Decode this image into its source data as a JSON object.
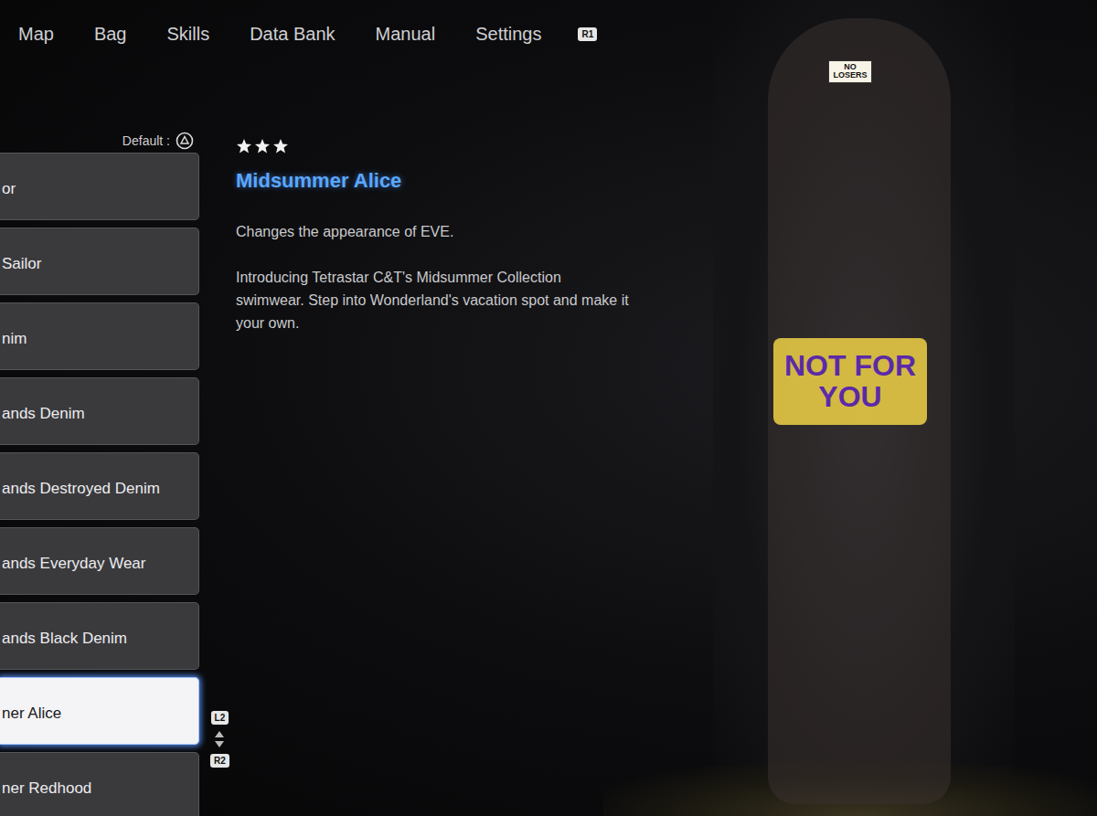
{
  "nav": {
    "items": [
      {
        "label": "Map"
      },
      {
        "label": "Bag"
      },
      {
        "label": "Skills"
      },
      {
        "label": "Data Bank"
      },
      {
        "label": "Manual"
      },
      {
        "label": "Settings"
      }
    ],
    "button": "R1"
  },
  "list": {
    "default_label": "Default :",
    "items": [
      {
        "label": "or",
        "selected": false
      },
      {
        "label": "Sailor",
        "selected": false
      },
      {
        "label": "nim",
        "selected": false
      },
      {
        "label": "ands Denim",
        "selected": false
      },
      {
        "label": "ands Destroyed Denim",
        "selected": false
      },
      {
        "label": "ands Everyday Wear",
        "selected": false
      },
      {
        "label": "ands Black Denim",
        "selected": false
      },
      {
        "label": "ner Alice",
        "selected": true
      },
      {
        "label": "ner Redhood",
        "selected": false
      }
    ]
  },
  "scroll": {
    "up_key": "L2",
    "down_key": "R2"
  },
  "detail": {
    "stars": 3,
    "title": "Midsummer Alice",
    "description": [
      "Changes the appearance of EVE.",
      "Introducing Tetrastar C&T's Midsummer Collection swimwear. Step into Wonderland's vacation spot and make it your own."
    ]
  },
  "preview": {
    "stickers": [
      {
        "text": "NO LOSERS"
      },
      {
        "text": "NOT FOR YOU"
      }
    ]
  }
}
